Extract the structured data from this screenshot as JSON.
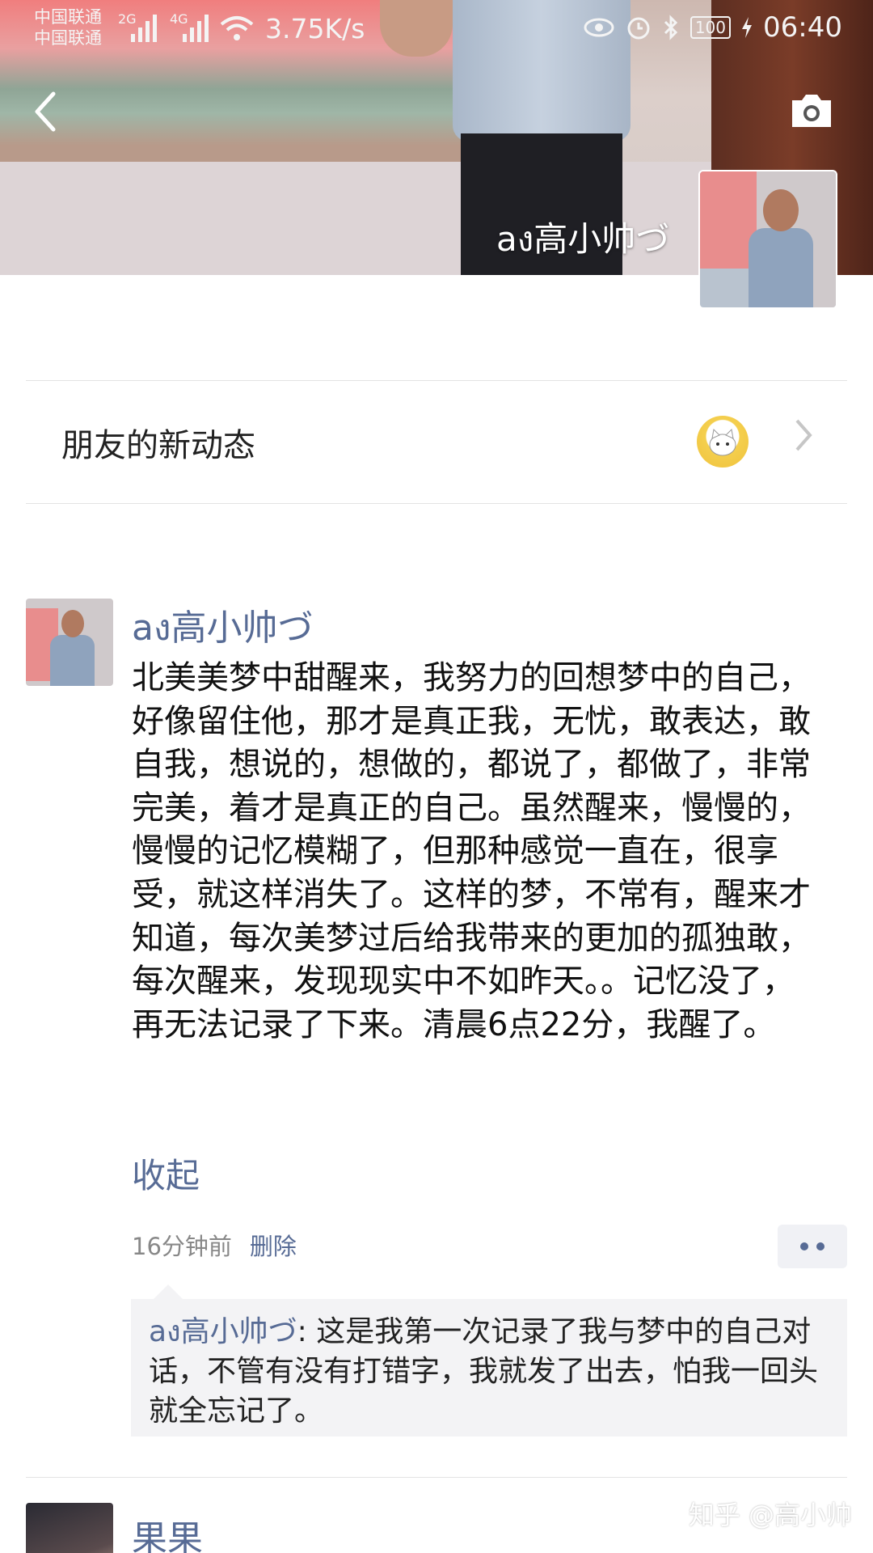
{
  "status_bar": {
    "carrier_1": "中国联通",
    "carrier_2": "中国联通",
    "signal_1": "2G",
    "signal_2": "4G",
    "net_speed": "3.75K/s",
    "battery": "100",
    "time": "06:40"
  },
  "cover": {
    "user_name": "aง高小帅づ"
  },
  "friends_activity": {
    "label": "朋友的新动态"
  },
  "post": {
    "author": "aง高小帅づ",
    "body": "北美美梦中甜醒来，我努力的回想梦中的自己，好像留住他，那才是真正我，无忧，敢表达，敢自我，想说的，想做的，都说了，都做了，非常完美，着才是真正的自己。虽然醒来，慢慢的，慢慢的记忆模糊了，但那种感觉一直在，很享受，就这样消失了。这样的梦，不常有，醒来才知道，每次美梦过后给我带来的更加的孤独敢，每次醒来，发现现实中不如昨天。。记忆没了，再无法记录了下来。清晨6点22分，我醒了。",
    "collapse_label": "收起",
    "time_ago": "16分钟前",
    "delete_label": "删除",
    "comment": {
      "author": "aง高小帅づ",
      "separator": ": ",
      "text": "这是我第一次记录了我与梦中的自己对话，不管有没有打错字，我就发了出去，怕我一回头就全忘记了。"
    }
  },
  "next_post": {
    "author": "果果"
  },
  "watermark": "知乎 @高小帅",
  "colors": {
    "link_blue": "#576b95",
    "comment_bg": "#f3f3f5"
  },
  "icons": {
    "back": "chevron-left-icon",
    "camera": "camera-icon",
    "chevron": "chevron-right-icon"
  }
}
